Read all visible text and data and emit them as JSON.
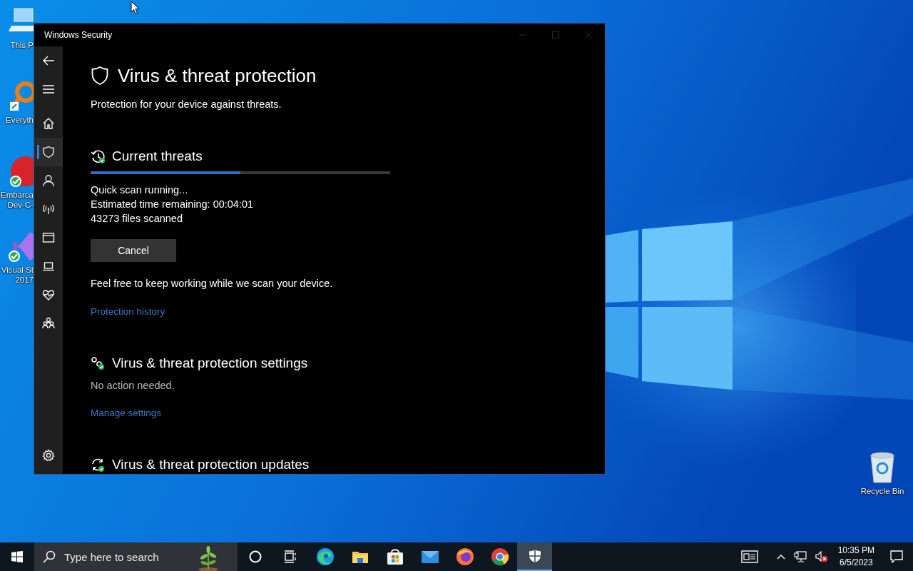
{
  "desktop": {
    "icons": [
      {
        "kind": "computer",
        "lines": [
          "This P"
        ]
      },
      {
        "kind": "magnifier",
        "lines": [
          "Everyth"
        ]
      },
      {
        "kind": "red-circle",
        "lines": [
          "Embarca",
          "Dev-C-"
        ]
      },
      {
        "kind": "purple-logo",
        "lines": [
          "Visual St",
          "2017"
        ]
      }
    ],
    "recycle_bin": {
      "label": "Recycle Bin"
    }
  },
  "window": {
    "title": "Windows Security",
    "nav": [
      {
        "kind": "back"
      },
      {
        "kind": "menu"
      },
      {
        "kind": "home",
        "selected": false
      },
      {
        "kind": "shield",
        "selected": true
      },
      {
        "kind": "person",
        "selected": false
      },
      {
        "kind": "signal",
        "selected": false
      },
      {
        "kind": "window",
        "selected": false
      },
      {
        "kind": "laptop",
        "selected": false
      },
      {
        "kind": "heart",
        "selected": false
      },
      {
        "kind": "family",
        "selected": false
      },
      {
        "kind": "settings",
        "selected": false
      }
    ],
    "page": {
      "title": "Virus & threat protection",
      "subtitle": "Protection for your device against threats.",
      "sections": [
        {
          "kind": "scan",
          "heading": "Current threats",
          "level": 0.5,
          "lines": [
            "Quick scan running...",
            "Estimated time remaining: 00:04:01",
            "43273 files scanned"
          ],
          "button": "Cancel",
          "note": "Feel free to keep working while we scan your device.",
          "link": "Protection history"
        },
        {
          "kind": "settings",
          "heading": "Virus & threat protection settings",
          "status": "No action needed.",
          "link": "Manage settings"
        },
        {
          "kind": "updates",
          "heading": "Virus & threat protection updates"
        }
      ]
    }
  },
  "taskbar": {
    "search": {
      "placeholder": "Type here to search"
    },
    "apps": [
      {
        "kind": "cortana",
        "selected": false
      },
      {
        "kind": "taskview",
        "selected": false
      },
      {
        "kind": "edge",
        "selected": false
      },
      {
        "kind": "folder",
        "selected": false
      },
      {
        "kind": "store",
        "selected": false
      },
      {
        "kind": "mail",
        "selected": false
      },
      {
        "kind": "firefox",
        "selected": false
      },
      {
        "kind": "chrome",
        "selected": false
      },
      {
        "kind": "security",
        "selected": true
      }
    ],
    "clock": {
      "time": "10:35 PM",
      "date": "6/5/2023"
    }
  }
}
